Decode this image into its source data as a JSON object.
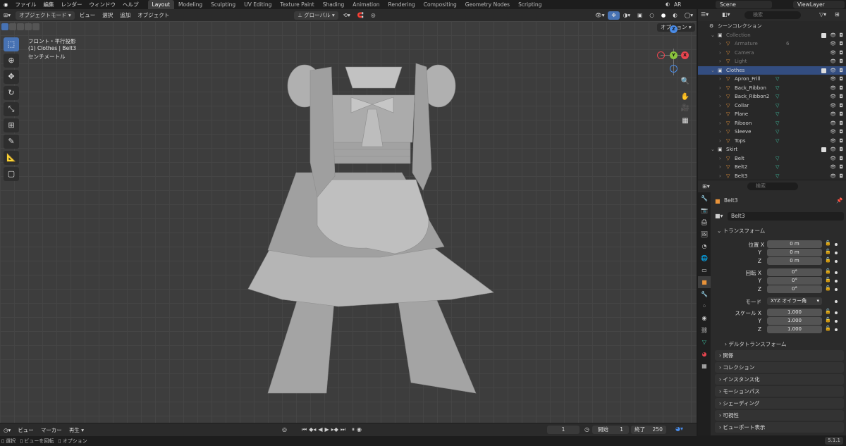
{
  "menu": [
    "ファイル",
    "編集",
    "レンダー",
    "ウィンドウ",
    "ヘルプ"
  ],
  "workspaces": [
    {
      "label": "Layout",
      "active": true
    },
    {
      "label": "Modeling"
    },
    {
      "label": "Sculpting"
    },
    {
      "label": "UV Editing"
    },
    {
      "label": "Texture Paint"
    },
    {
      "label": "Shading"
    },
    {
      "label": "Animation"
    },
    {
      "label": "Rendering"
    },
    {
      "label": "Compositing"
    },
    {
      "label": "Geometry Nodes"
    },
    {
      "label": "Scripting"
    }
  ],
  "scene": {
    "ar_label": "AR",
    "scene_name": "Scene",
    "view_layer": "ViewLayer"
  },
  "viewport_header": {
    "mode": "オブジェクトモード",
    "view": "ビュー",
    "select": "選択",
    "add": "追加",
    "object": "オブジェクト",
    "orientation": "グローバル",
    "options": "オプション"
  },
  "overlay": {
    "view_name": "フロント・平行投影",
    "object_info": "(1) Clothes | Belt3",
    "units": "センチメートル"
  },
  "gizmo": {
    "x": "X",
    "y": "Y",
    "z": "Z"
  },
  "outliner": {
    "search_placeholder": "検索",
    "rows": [
      {
        "label": "シーンコレクション",
        "indent": 0,
        "type": "scene"
      },
      {
        "label": "Collection",
        "indent": 1,
        "type": "collection",
        "dim": true,
        "checked": true
      },
      {
        "label": "Armature",
        "indent": 2,
        "type": "object",
        "dim": true,
        "extra": "6"
      },
      {
        "label": "Camera",
        "indent": 2,
        "type": "object",
        "dim": true
      },
      {
        "label": "Light",
        "indent": 2,
        "type": "object",
        "dim": true
      },
      {
        "label": "Clothes",
        "indent": 1,
        "type": "collection",
        "selected": true,
        "checked": true
      },
      {
        "label": "Apron_Frill",
        "indent": 2,
        "type": "mesh"
      },
      {
        "label": "Back_Ribbon",
        "indent": 2,
        "type": "mesh"
      },
      {
        "label": "Back_Ribbon2",
        "indent": 2,
        "type": "mesh"
      },
      {
        "label": "Collar",
        "indent": 2,
        "type": "mesh"
      },
      {
        "label": "Plane",
        "indent": 2,
        "type": "mesh"
      },
      {
        "label": "Riboon",
        "indent": 2,
        "type": "mesh"
      },
      {
        "label": "Sleeve",
        "indent": 2,
        "type": "mesh"
      },
      {
        "label": "Tops",
        "indent": 2,
        "type": "mesh"
      },
      {
        "label": "Skirt",
        "indent": 1,
        "type": "collection",
        "checked": true
      },
      {
        "label": "Belt",
        "indent": 2,
        "type": "mesh"
      },
      {
        "label": "Belt2",
        "indent": 2,
        "type": "mesh"
      },
      {
        "label": "Belt3",
        "indent": 2,
        "type": "mesh"
      }
    ]
  },
  "properties": {
    "search_placeholder": "検索",
    "object_name": "Belt3",
    "object_field": "Belt3",
    "transform_title": "トランスフォーム",
    "location": {
      "label_x": "位置 X",
      "label_y": "Y",
      "label_z": "Z",
      "x": "0 m",
      "y": "0 m",
      "z": "0 m"
    },
    "rotation": {
      "label_x": "回転 X",
      "label_y": "Y",
      "label_z": "Z",
      "x": "0°",
      "y": "0°",
      "z": "0°"
    },
    "mode": {
      "label": "モード",
      "value": "XYZ オイラー角"
    },
    "scale": {
      "label_x": "スケール X",
      "label_y": "Y",
      "label_z": "Z",
      "x": "1.000",
      "y": "1.000",
      "z": "1.000"
    },
    "delta_transform": "デルタトランスフォーム",
    "panels": [
      "関係",
      "コレクション",
      "インスタンス化",
      "モーションパス",
      "シェーディング",
      "可視性",
      "ビューポート表示"
    ]
  },
  "timeline": {
    "view": "ビュー",
    "marker": "マーカー",
    "playback": "再生",
    "current_frame": "1",
    "start_label": "開始",
    "start": "1",
    "end_label": "終了",
    "end": "250"
  },
  "statusbar": {
    "select": "選択",
    "rotate": "ビューを回転",
    "options": "オプション",
    "version": "5.1.1"
  },
  "colors": {
    "accent": "#4772b3",
    "mesh_icon": "#3ec2a3",
    "object_icon": "#e8933a",
    "x_axis": "#e8454f",
    "y_axis": "#8ac43d",
    "z_axis": "#4a8ce8"
  }
}
